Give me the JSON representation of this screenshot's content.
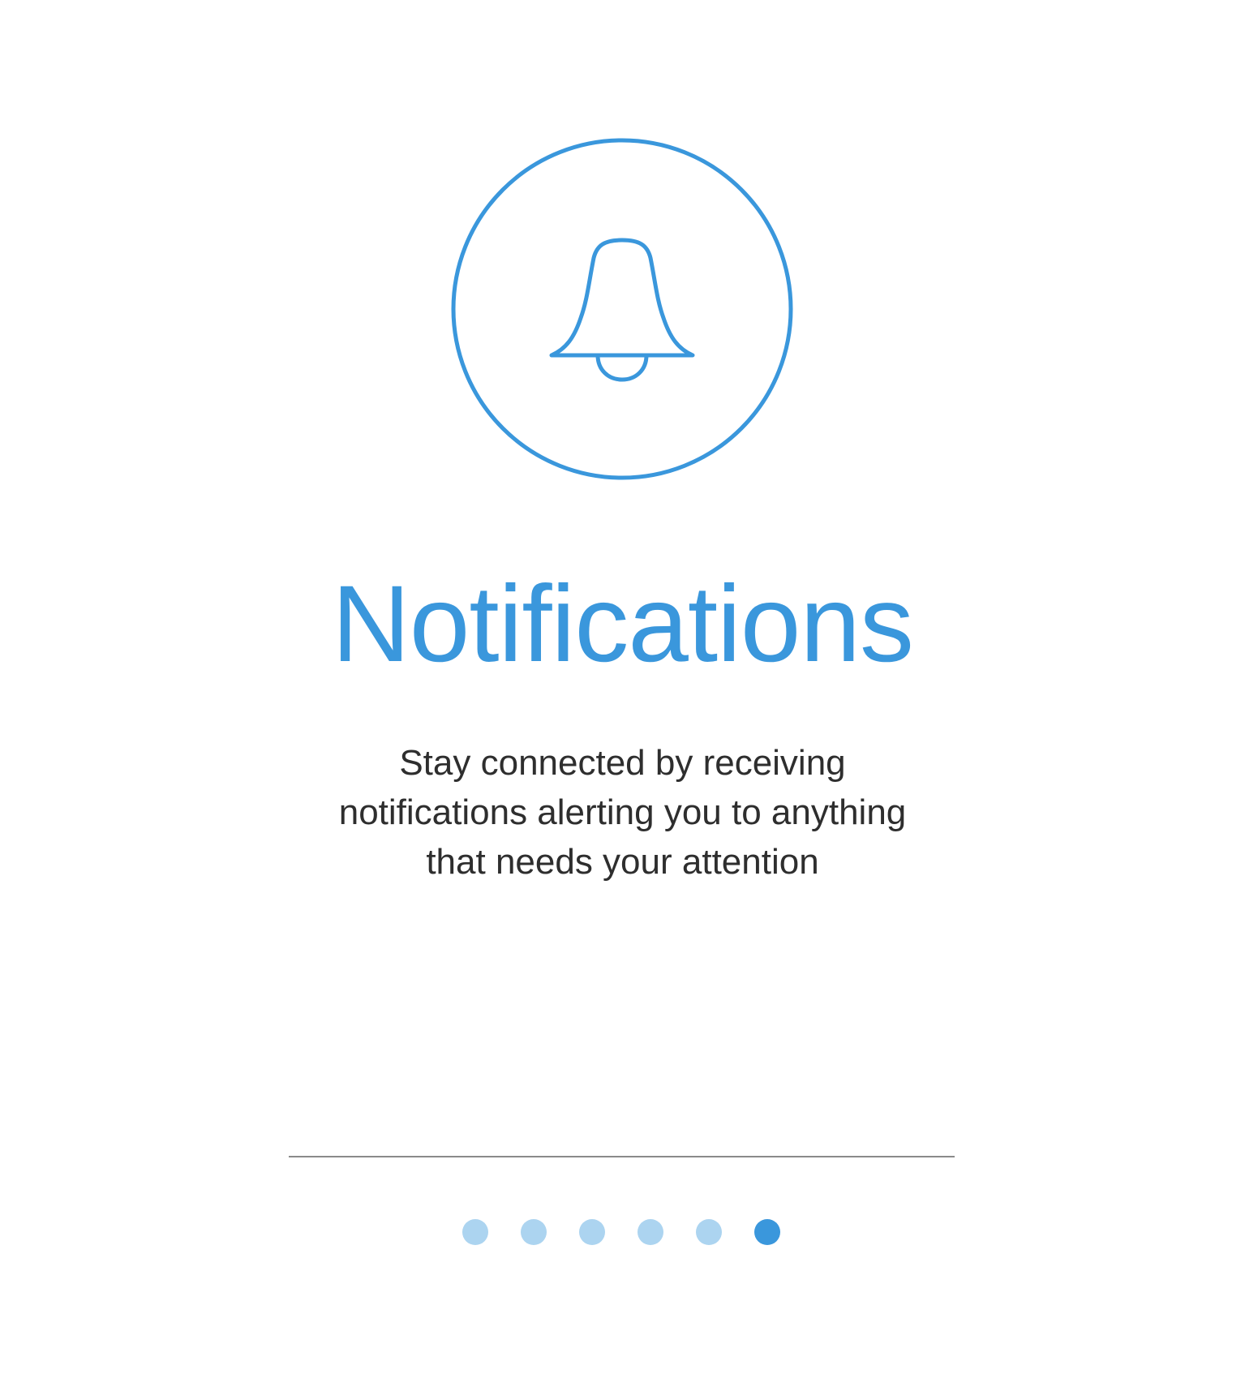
{
  "onboarding": {
    "icon": "bell-icon",
    "title": "Notifications",
    "description_lines": [
      "Stay connected by receiving",
      "notifications alerting you to anything",
      "that needs your attention"
    ]
  },
  "pager": {
    "total_pages": 6,
    "current_page": 6
  },
  "colors": {
    "accent": "#3a97dc",
    "dot_inactive": "#acd4f0",
    "body_text": "#2e2e2e",
    "divider": "#8a8a8a"
  }
}
